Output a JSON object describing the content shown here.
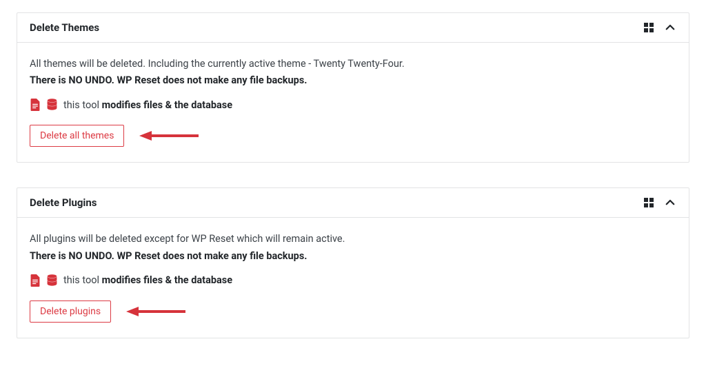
{
  "panels": {
    "themes": {
      "title": "Delete Themes",
      "description": "All themes will be deleted. Including the currently active theme - Twenty Twenty-Four.",
      "warning": "There is NO UNDO. WP Reset does not make any file backups.",
      "mod_lead": "this tool ",
      "mod_bold": "modifies files & the database",
      "button_label": "Delete all themes"
    },
    "plugins": {
      "title": "Delete Plugins",
      "description": "All plugins will be deleted except for WP Reset which will remain active.",
      "warning": "There is NO UNDO. WP Reset does not make any file backups.",
      "mod_lead": "this tool ",
      "mod_bold": "modifies files & the database",
      "button_label": "Delete plugins"
    }
  },
  "colors": {
    "danger": "#dc3a43",
    "border": "#e2e3e4",
    "text": "#3c4248",
    "heading": "#22262a"
  }
}
